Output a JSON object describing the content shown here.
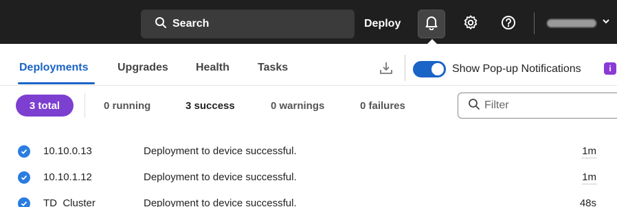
{
  "header": {
    "search_label": "Search",
    "deploy_label": "Deploy",
    "colors": {
      "bar": "#1f1f1f",
      "search_bg": "#3b3b3b"
    }
  },
  "tabs": [
    {
      "label": "Deployments",
      "active": true
    },
    {
      "label": "Upgrades",
      "active": false
    },
    {
      "label": "Health",
      "active": false
    },
    {
      "label": "Tasks",
      "active": false
    }
  ],
  "notifications": {
    "toggle_label": "Show Pop-up Notifications",
    "toggle_on": true,
    "info_glyph": "i"
  },
  "summary": {
    "total": "3 total",
    "running": "0 running",
    "success": "3 success",
    "warnings": "0 warnings",
    "failures": "0 failures"
  },
  "filter": {
    "placeholder": "Filter",
    "value": ""
  },
  "deployments": [
    {
      "device": "10.10.0.13",
      "message": "Deployment to device successful.",
      "time": "1m"
    },
    {
      "device": "10.10.1.12",
      "message": "Deployment to device successful.",
      "time": "1m"
    },
    {
      "device": "TD_Cluster",
      "message": "Deployment to device successful.",
      "time": "48s"
    }
  ],
  "icons": [
    "search-icon",
    "bell-icon",
    "gear-icon",
    "help-icon",
    "chevron-down-icon",
    "download-icon",
    "info-icon",
    "check-circle-icon"
  ],
  "accent": "#1a63c7",
  "pill_color": "#7d3fd0"
}
